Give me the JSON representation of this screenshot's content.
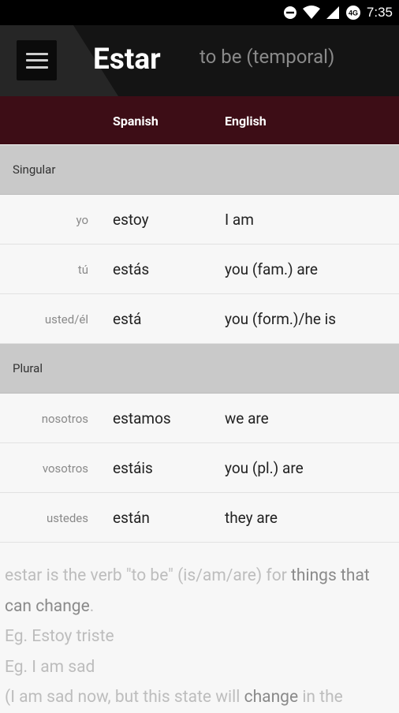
{
  "status": {
    "time": "7:35",
    "network_label": "4G"
  },
  "appbar": {
    "title": "Estar",
    "subtitle": "to be (temporal)"
  },
  "table": {
    "headers": {
      "spanish": "Spanish",
      "english": "English"
    },
    "sections": [
      {
        "label": "Singular",
        "rows": [
          {
            "pronoun": "yo",
            "spanish": "estoy",
            "english": "I am"
          },
          {
            "pronoun": "tú",
            "spanish": "estás",
            "english": "you (fam.) are"
          },
          {
            "pronoun": "usted/él",
            "spanish": "está",
            "english": "you (form.)/he is"
          }
        ]
      },
      {
        "label": "Plural",
        "rows": [
          {
            "pronoun": "nosotros",
            "spanish": "estamos",
            "english": "we are"
          },
          {
            "pronoun": "vosotros",
            "spanish": "estáis",
            "english": "you (pl.) are"
          },
          {
            "pronoun": "ustedes",
            "spanish": "están",
            "english": "they are"
          }
        ]
      }
    ]
  },
  "notes": {
    "line1_a": "estar is the verb \"to be\" (is/am/are) for ",
    "line1_b": "things that",
    "line2_a": "can change",
    "line2_b": ".",
    "line3": "Eg. Estoy triste",
    "line4": "Eg. I am sad",
    "line5_a": "(I am sad now, but this state will ",
    "line5_b": "change",
    "line5_c": " in the"
  }
}
